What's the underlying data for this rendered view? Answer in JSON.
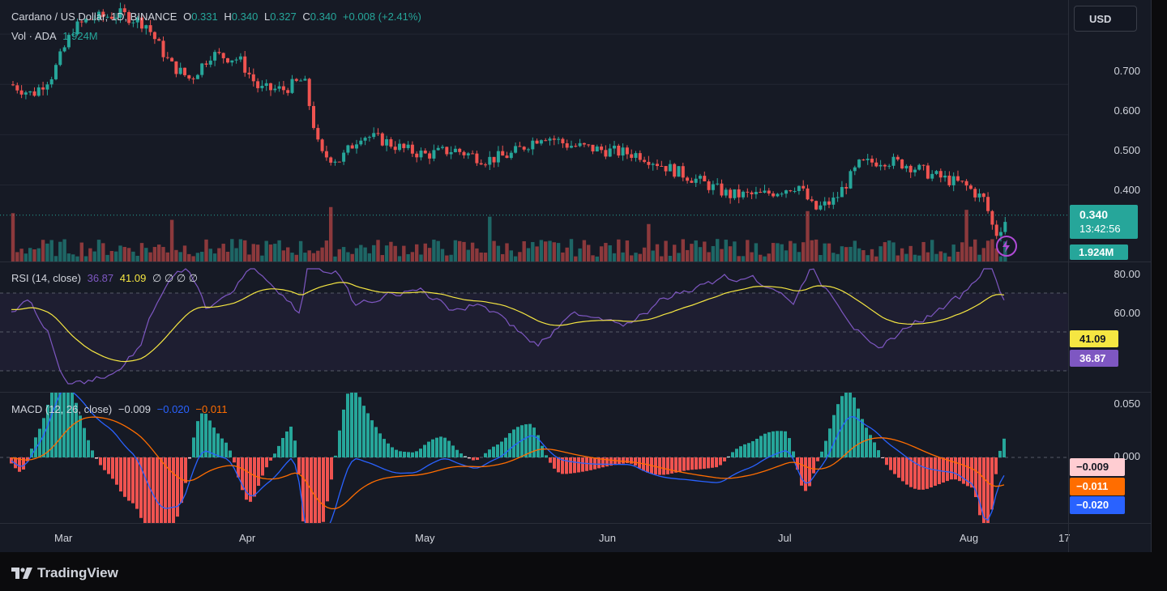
{
  "header": {
    "symbol": "Cardano / US Dollar, 1D, BINANCE",
    "o_label": "O",
    "o_val": "0.331",
    "h_label": "H",
    "h_val": "0.340",
    "l_label": "L",
    "l_val": "0.327",
    "c_label": "C",
    "c_val": "0.340",
    "change": "+0.008 (+2.41%)",
    "vol_label": "Vol · ADA",
    "vol_val": "1.924M"
  },
  "currency_button": "USD",
  "price_axis": {
    "ticks": [
      "0.700",
      "0.600",
      "0.500",
      "0.400"
    ],
    "last_price": "0.340",
    "countdown": "13:42:56",
    "last_volume": "1.924M"
  },
  "rsi": {
    "label": "RSI (14, close)",
    "rsi_val": "36.87",
    "ma_val": "41.09",
    "extra": "∅ ∅ ∅ ∅",
    "ticks": [
      "80.00",
      "60.00"
    ]
  },
  "macd": {
    "label": "MACD (12, 26, close)",
    "hist_val": "−0.009",
    "macd_val": "−0.020",
    "signal_val": "−0.011",
    "ticks": [
      "0.050",
      "0.000"
    ],
    "tag_hist": "−0.009",
    "tag_signal": "−0.011",
    "tag_macd": "−0.020"
  },
  "time_axis": {
    "labels": [
      "Mar",
      "Apr",
      "May",
      "Jun",
      "Jul",
      "Aug",
      "17"
    ]
  },
  "footer": {
    "brand": "TradingView"
  },
  "colors": {
    "up": "#26a69a",
    "down": "#ef5350",
    "rsi": "#7e57c2",
    "rsi_ma": "#f5e642",
    "macd": "#2962ff",
    "signal": "#ff6d00",
    "bg": "#161a25"
  },
  "chart_data": {
    "type": "candlestick",
    "ohlc_sampled": [
      {
        "date": "Mar",
        "c": 0.6
      },
      {
        "date": "Mar-mid",
        "c": 0.72
      },
      {
        "date": "Apr",
        "c": 0.58
      },
      {
        "date": "Apr-mid",
        "c": 0.47
      },
      {
        "date": "May",
        "c": 0.45
      },
      {
        "date": "May-mid",
        "c": 0.5
      },
      {
        "date": "Jun",
        "c": 0.46
      },
      {
        "date": "Jun-mid",
        "c": 0.39
      },
      {
        "date": "Jul",
        "c": 0.37
      },
      {
        "date": "Jul-mid",
        "c": 0.45
      },
      {
        "date": "Aug",
        "c": 0.38
      },
      {
        "date": "Aug-latest",
        "c": 0.34
      }
    ],
    "ylim": [
      0.34,
      0.78
    ]
  }
}
